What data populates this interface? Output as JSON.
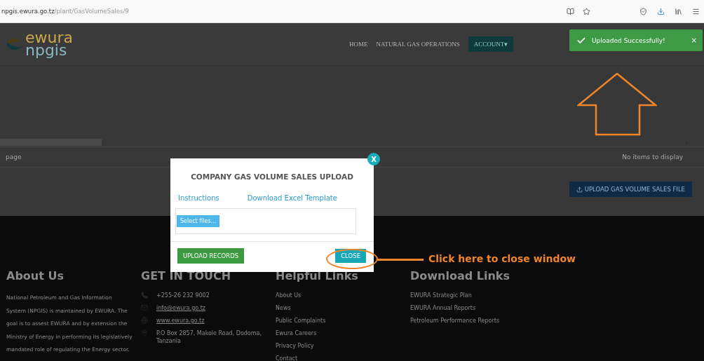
{
  "browser": {
    "url_host": "npgis.ewura.go.tz",
    "url_path": "/plant/GasVolumeSales/9"
  },
  "header": {
    "logo_top": "ewura",
    "logo_bottom": "npgis",
    "nav": [
      {
        "label": "HOME",
        "kind": "link"
      },
      {
        "label": "NATURAL GAS OPERATIONS",
        "kind": "link"
      },
      {
        "label": "ACCOUNT▾",
        "kind": "button"
      }
    ]
  },
  "toast": {
    "message": "Uploaded Successfully!",
    "close": "×"
  },
  "grid": {
    "pager": "page",
    "empty": "No items to display"
  },
  "upload_button": "UPLOAD GAS VOLUME SALES FILE",
  "modal": {
    "title": "COMPANY GAS VOLUME SALES UPLOAD",
    "links": [
      "Instructions",
      "Download Excel Template"
    ],
    "select": "Select files...",
    "upload": "UPLOAD RECORDS",
    "close": "CLOSE",
    "close_x": "X"
  },
  "annotation": {
    "text": "Click here to close window"
  },
  "footer": {
    "about": {
      "heading": "About Us",
      "text": "National Petroleum and Gas Information System (NPGIS) is maintained by EWURA. The goal is to assest EWURA and by extension the Ministry of Energy in performing its legislatively mandated role of regulating the Energy sector."
    },
    "contact": {
      "heading": "GET IN TOUCH",
      "items": [
        {
          "kind": "phone",
          "text": "+255-26 232 9002"
        },
        {
          "kind": "email",
          "text": "info@ewura.go.tz"
        },
        {
          "kind": "web",
          "text": "www.ewura.go.tz"
        },
        {
          "kind": "address",
          "text": "P.O Box 2857, Makole Road, Dodoma, Tanzania"
        }
      ]
    },
    "helpful": {
      "heading": "Helpful Links",
      "links": [
        "About Us",
        "News",
        "Public Complaints",
        "Ewura Careers",
        "Privacy Policy",
        "Contact"
      ]
    },
    "downloads": {
      "heading": "Download Links",
      "links": [
        "EWURA Strategic Plan",
        "EWURA Annual Reports",
        "Petroleum Performance Reports"
      ]
    }
  }
}
